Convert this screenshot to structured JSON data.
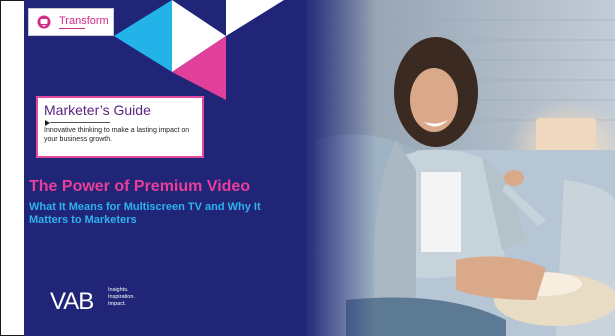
{
  "brand": {
    "name": "Transform",
    "accent": "#d52a8a"
  },
  "guide": {
    "title": "Marketer’s Guide",
    "subtitle": "Innovative thinking to make a lasting impact on your business growth."
  },
  "headline": {
    "title": "The Power of Premium Video",
    "subtitle": "What It Means for Multiscreen TV and Why It Matters to Marketers"
  },
  "footer": {
    "logo": "VAB",
    "tagline": [
      "Insights.",
      "Inspiration.",
      "Impact."
    ]
  },
  "colors": {
    "panel": "#202577",
    "pink": "#e93d98",
    "cyan": "#2fb2ee",
    "purple": "#5b2480"
  }
}
